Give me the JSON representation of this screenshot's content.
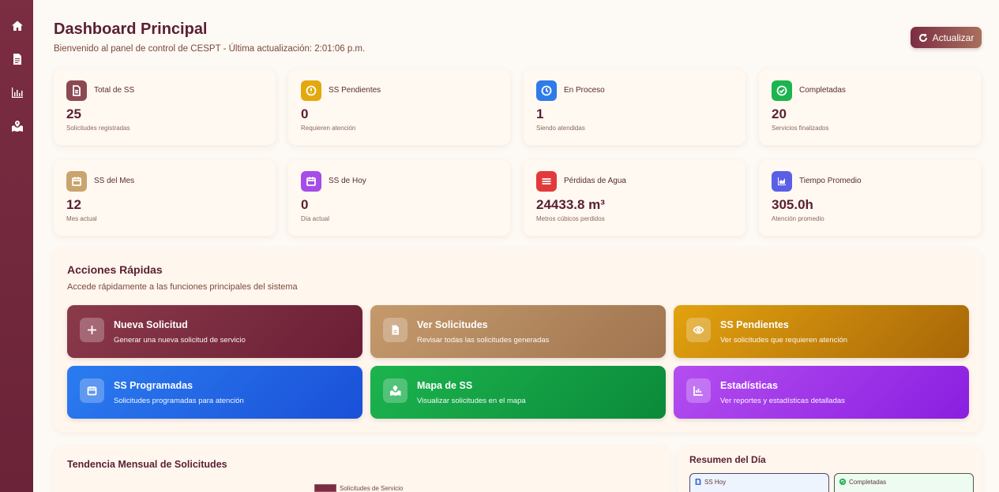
{
  "sidebar": {
    "icons": [
      "home-icon",
      "document-icon",
      "chart-icon",
      "map-icon"
    ]
  },
  "header": {
    "title": "Dashboard Principal",
    "subtitle": "Bienvenido al panel de control de CESPT - Última actualización: 2:01:06 p.m.",
    "refresh_label": "Actualizar"
  },
  "stats": [
    {
      "label": "Total de SS",
      "value": "25",
      "desc": "Solicitudes registradas",
      "icon": "document-icon",
      "color": "#8b4a52"
    },
    {
      "label": "SS Pendientes",
      "value": "0",
      "desc": "Requieren atención",
      "icon": "alert-icon",
      "color": "#e2a90f"
    },
    {
      "label": "En Proceso",
      "value": "1",
      "desc": "Siendo atendidas",
      "icon": "clock-icon",
      "color": "#2f7be8"
    },
    {
      "label": "Completadas",
      "value": "20",
      "desc": "Servicios finalizados",
      "icon": "check-icon",
      "color": "#1cb44e"
    },
    {
      "label": "SS del Mes",
      "value": "12",
      "desc": "Mes actual",
      "icon": "calendar-icon",
      "color": "#c9a46c"
    },
    {
      "label": "SS de Hoy",
      "value": "0",
      "desc": "Día actual",
      "icon": "calendar-icon",
      "color": "#a64ce8"
    },
    {
      "label": "Pérdidas de Agua",
      "value": "24433.8 m³",
      "desc": "Metros cúbicos perdidos",
      "icon": "waves-icon",
      "color": "#e23a3a"
    },
    {
      "label": "Tiempo Promedio",
      "value": "305.0h",
      "desc": "Atención promedio",
      "icon": "chart-icon",
      "color": "#5b5fe6"
    }
  ],
  "quick_actions": {
    "title": "Acciones Rápidas",
    "subtitle": "Accede rápidamente a las funciones principales del sistema",
    "items": [
      {
        "title": "Nueva Solicitud",
        "desc": "Generar una nueva solicitud de servicio",
        "icon": "plus-icon",
        "color_from": "#8b3a4a",
        "color_to": "#6a1e35"
      },
      {
        "title": "Ver Solicitudes",
        "desc": "Revisar todas las solicitudes generadas",
        "icon": "document-icon",
        "color_from": "#c49a6c",
        "color_to": "#a07550"
      },
      {
        "title": "SS Pendientes",
        "desc": "Ver solicitudes que requieren atención",
        "icon": "eye-icon",
        "color_from": "#e2a20f",
        "color_to": "#a86608"
      },
      {
        "title": "SS Programadas",
        "desc": "Solicitudes programadas para atención",
        "icon": "calendar-icon",
        "color_from": "#2b7cf0",
        "color_to": "#1a50d8"
      },
      {
        "title": "Mapa de SS",
        "desc": "Visualizar solicitudes en el mapa",
        "icon": "map-icon",
        "color_from": "#1cb44e",
        "color_to": "#0b8a3a"
      },
      {
        "title": "Estadísticas",
        "desc": "Ver reportes y estadísticas detalladas",
        "icon": "chart-icon",
        "color_from": "#b44ef0",
        "color_to": "#8a1ee0"
      }
    ]
  },
  "trend": {
    "title": "Tendencia Mensual de Solicitudes",
    "legend": "Solicitudes de Servicio"
  },
  "summary": {
    "title": "Resumen del Día",
    "boxes": [
      {
        "label": "SS Hoy",
        "icon": "document-icon",
        "bg": "#eef4fd",
        "border": "#4a4a6a",
        "stroke": "#3a6ad8"
      },
      {
        "label": "Completadas",
        "icon": "check-icon",
        "bg": "#eefbf0",
        "border": "#4a5a4a",
        "stroke": "#1cb44e"
      }
    ]
  }
}
